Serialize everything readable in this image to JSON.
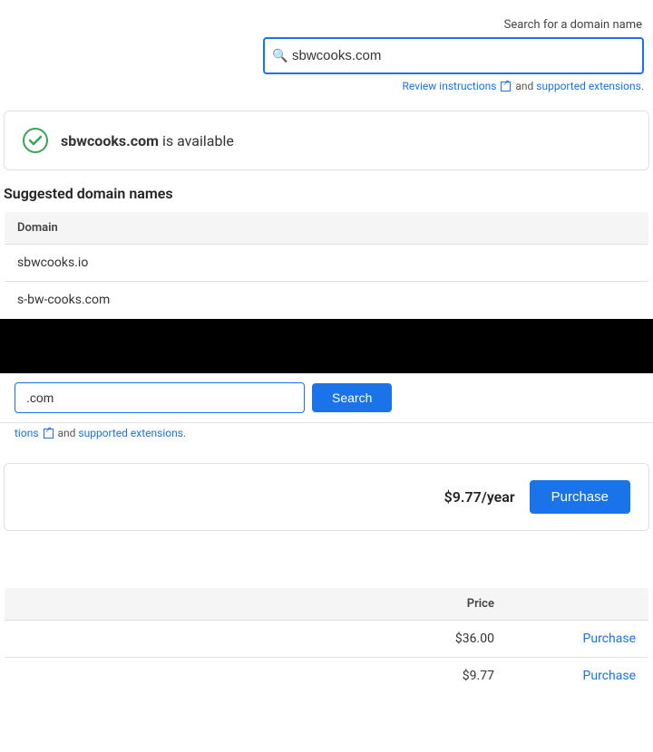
{
  "search": {
    "label": "Search for a domain name",
    "placeholder": "sbwcooks.com",
    "value": "sbwcooks.com",
    "button_label": "Search"
  },
  "instructions": {
    "review_text": "Review instructions",
    "and_text": "and",
    "supported_text": "supported extensions",
    "period": "."
  },
  "available_domain": {
    "domain": "sbwcooks.com",
    "status_text": "is available"
  },
  "suggested_section": {
    "title": "Suggested domain names",
    "table_header_domain": "Domain",
    "rows": [
      {
        "domain": "sbwcooks.io"
      },
      {
        "domain": "s-bw-cooks.com"
      }
    ]
  },
  "purchase_section": {
    "price": "$9.77/year",
    "button_label": "Purchase"
  },
  "price_table": {
    "header_price": "Price",
    "rows": [
      {
        "domain": "",
        "price": "$36.00",
        "action": "Purchase"
      },
      {
        "domain": "",
        "price": "$9.77",
        "action": "Purchase"
      }
    ]
  },
  "bottom_search": {
    "value": ".com",
    "button_label": "Search"
  }
}
